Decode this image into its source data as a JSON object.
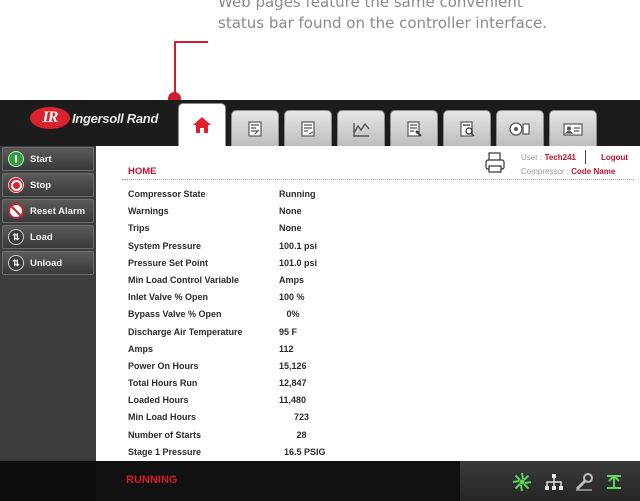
{
  "callout": {
    "line1": "Web pages feature the same convenient",
    "line2": "status bar found on the controller interface."
  },
  "logo": {
    "mark": "IR",
    "text": "Ingersoll Rand"
  },
  "colors": {
    "brand_red": "#cf1f2f",
    "status_red": "#d8192c",
    "title_red": "#c8102e",
    "start_green": "#2e9e3e",
    "reset_red": "#c0262e"
  },
  "tabs": [
    {
      "icon": "home-icon",
      "active": true
    },
    {
      "icon": "config-sheet-icon"
    },
    {
      "icon": "settings-sheet-icon"
    },
    {
      "icon": "trend-chart-icon"
    },
    {
      "icon": "maintenance-sheet-icon"
    },
    {
      "icon": "event-log-icon"
    },
    {
      "icon": "sequencing-icon"
    },
    {
      "icon": "user-card-icon"
    }
  ],
  "sidebar": {
    "start": "Start",
    "stop": "Stop",
    "reset_alarm": "Reset Alarm",
    "load": "Load",
    "unload": "Unload"
  },
  "header": {
    "page_title": "HOME",
    "user_label": "User :",
    "user_value": "Tech241",
    "compressor_label": "Compressor :",
    "compressor_value": "Code Name",
    "logout": "Logout"
  },
  "rows": [
    {
      "label": "Compressor State",
      "value": "Running"
    },
    {
      "label": "Warnings",
      "value": "None"
    },
    {
      "label": "Trips",
      "value": "None"
    },
    {
      "label": "System Pressure",
      "value": "100.1 psi"
    },
    {
      "label": "Pressure Set Point",
      "value": "101.0 psi"
    },
    {
      "label": "Min Load Control Variable",
      "value": "Amps"
    },
    {
      "label": "Inlet Valve % Open",
      "value": "100 %"
    },
    {
      "label": "Bypass Valve % Open",
      "value": "   0%"
    },
    {
      "label": "Discharge Air Temperature",
      "value": "95 F"
    },
    {
      "label": "Amps",
      "value": "112"
    },
    {
      "label": "Power On Hours",
      "value": "15,126"
    },
    {
      "label": "Total Hours Run",
      "value": "12,847"
    },
    {
      "label": "Loaded Hours",
      "value": "11,480"
    },
    {
      "label": "Min Load Hours",
      "value": "      723"
    },
    {
      "label": "Number of Starts",
      "value": "       28"
    },
    {
      "label": "Stage 1 Pressure",
      "value": "  16.5 PSIG"
    }
  ],
  "footer": {
    "status": "RUNNING",
    "icons": [
      "fan-running-icon",
      "network-icon",
      "wrench-icon",
      "load-status-icon"
    ]
  }
}
